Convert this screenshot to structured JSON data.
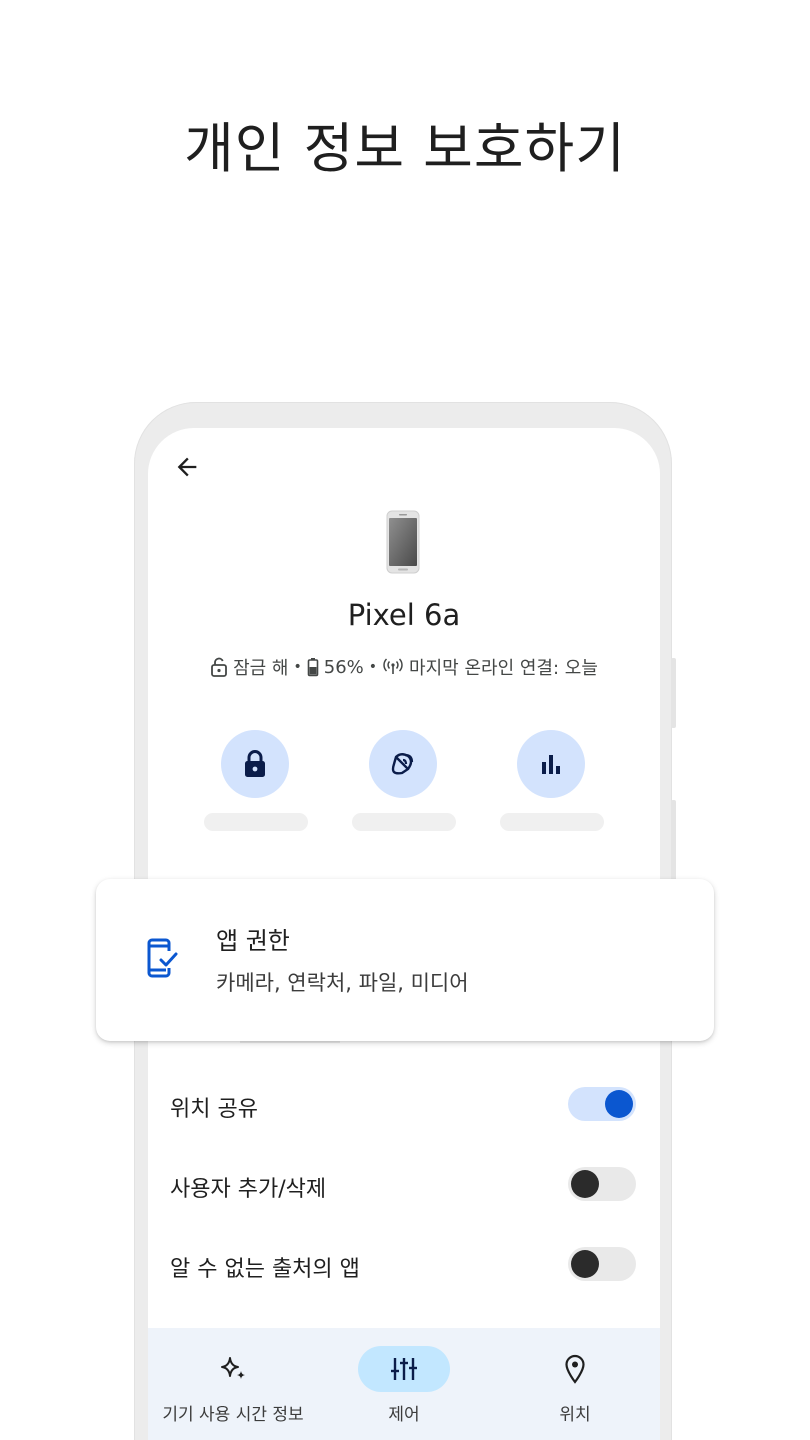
{
  "headline": "개인 정보 보호하기",
  "device": {
    "name": "Pixel 6a",
    "status": {
      "lock_icon": "lock-open-icon",
      "lock_text": "잠금 해",
      "separator": "•",
      "battery_icon": "battery-icon",
      "battery_text": "56%",
      "signal_icon": "signal-icon",
      "last_online_text": "마지막 온라인 연결: 오늘"
    }
  },
  "actions": [
    {
      "icon": "lock-icon"
    },
    {
      "icon": "ring-sound-icon"
    },
    {
      "icon": "bar-chart-icon"
    }
  ],
  "permission_card": {
    "icon": "phone-check-icon",
    "title": "앱 권한",
    "subtitle": "카메라, 연락처, 파일, 미디어"
  },
  "toggles": [
    {
      "label": "위치 공유",
      "on": true
    },
    {
      "label": "사용자 추가/삭제",
      "on": false
    },
    {
      "label": "알 수 없는 출처의 앱",
      "on": false
    }
  ],
  "bottom_nav": [
    {
      "icon": "sparkle-icon",
      "label": "기기 사용 시간 정보",
      "active": false
    },
    {
      "icon": "tune-sliders-icon",
      "label": "제어",
      "active": true
    },
    {
      "icon": "location-pin-icon",
      "label": "위치",
      "active": false
    }
  ],
  "colors": {
    "accent": "#0b57d0",
    "accent_container": "#d3e3fd",
    "nav_background": "#eef3fa",
    "nav_active": "#c2e7ff"
  }
}
